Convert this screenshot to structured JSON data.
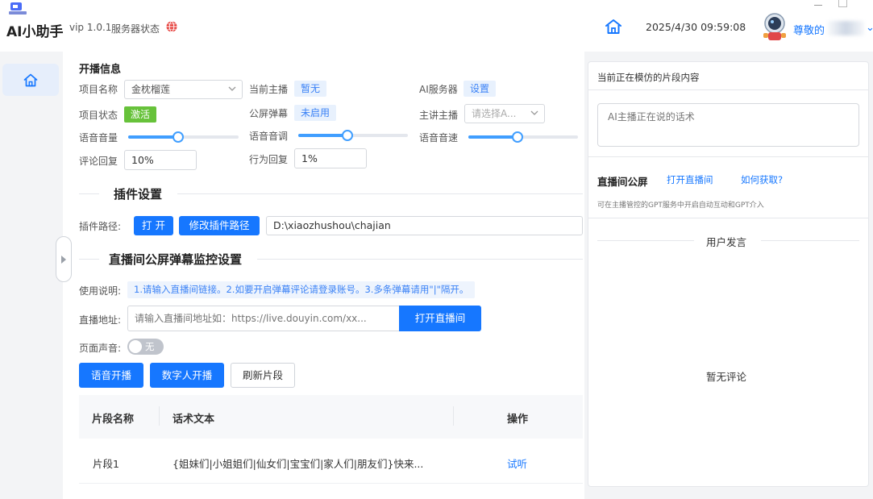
{
  "app": {
    "title": "AI小助手",
    "version": "vip 1.0.1",
    "server_status_label": "服务器状态",
    "datetime": "2025/4/30 09:59:08",
    "user_greeting": "尊敬的",
    "icons": [
      "app-logo-icon",
      "globe-icon",
      "home-icon",
      "avatar"
    ]
  },
  "sidebar": {
    "items": [
      {
        "name": "home",
        "icon": "home-icon"
      }
    ]
  },
  "broadcast": {
    "section_title": "开播信息",
    "project_name_label": "项目名称",
    "project_name_value": "金枕榴莲",
    "project_status_label": "项目状态",
    "project_status_value": "激活",
    "current_host_label": "当前主播",
    "current_host_value": "暂无",
    "public_danmu_label": "公屏弹幕",
    "public_danmu_value": "未启用",
    "ai_server_label": "AI服务器",
    "ai_server_value": "设置",
    "main_host_label": "主讲主播",
    "main_host_placeholder": "请选择A...",
    "voice_volume_label": "语音音量",
    "voice_volume": 0.45,
    "voice_pitch_label": "语音音调",
    "voice_pitch": 0.45,
    "voice_speed_label": "语音音速",
    "voice_speed": 0.45,
    "comment_reply_label": "评论回复",
    "comment_reply_value": "10%",
    "action_reply_label": "行为回复",
    "action_reply_value": "1%"
  },
  "plugin": {
    "section_title": "插件设置",
    "path_label": "插件路径:",
    "open_button": "打 开",
    "modify_button": "修改插件路径",
    "path_value": "D:\\xiaozhushou\\chajian"
  },
  "monitor": {
    "section_title": "直播间公屏弹幕监控设置",
    "usage_label": "使用说明:",
    "usage_text": "1.请输入直播间链接。2.如要开启弹幕评论请登录账号。3.多条弹幕请用\"|\"隔开。",
    "url_label": "直播地址:",
    "url_placeholder": "请输入直播间地址如：https://live.douyin.com/xx...",
    "open_live_button": "打开直播间",
    "page_sound_label": "页面声音:",
    "page_sound_toggle": "无",
    "voice_start_button": "语音开播",
    "digital_start_button": "数字人开播",
    "refresh_button": "刷新片段"
  },
  "table": {
    "headers": [
      "片段名称",
      "话术文本",
      "操作"
    ],
    "rows": [
      {
        "name": "片段1",
        "text": "{姐妹们|小姐姐们|仙女们|宝宝们|家人们|朋友们}快来...",
        "action": "试听"
      }
    ]
  },
  "right_panel": {
    "imitating_title": "当前正在模仿的片段内容",
    "script_placeholder": "AI主播正在说的话术",
    "public_screen_title": "直播间公屏",
    "open_live_link": "打开直播间",
    "how_to_get_link": "如何获取?",
    "public_screen_hint": "可在主播管控的GPT服务中开启自动互动和GPT介入",
    "user_speech_title": "用户发言",
    "no_comments": "暂无评论"
  },
  "colors": {
    "primary": "#1677ff",
    "success": "#67c23a",
    "tag_bg": "#e8f1fd"
  }
}
